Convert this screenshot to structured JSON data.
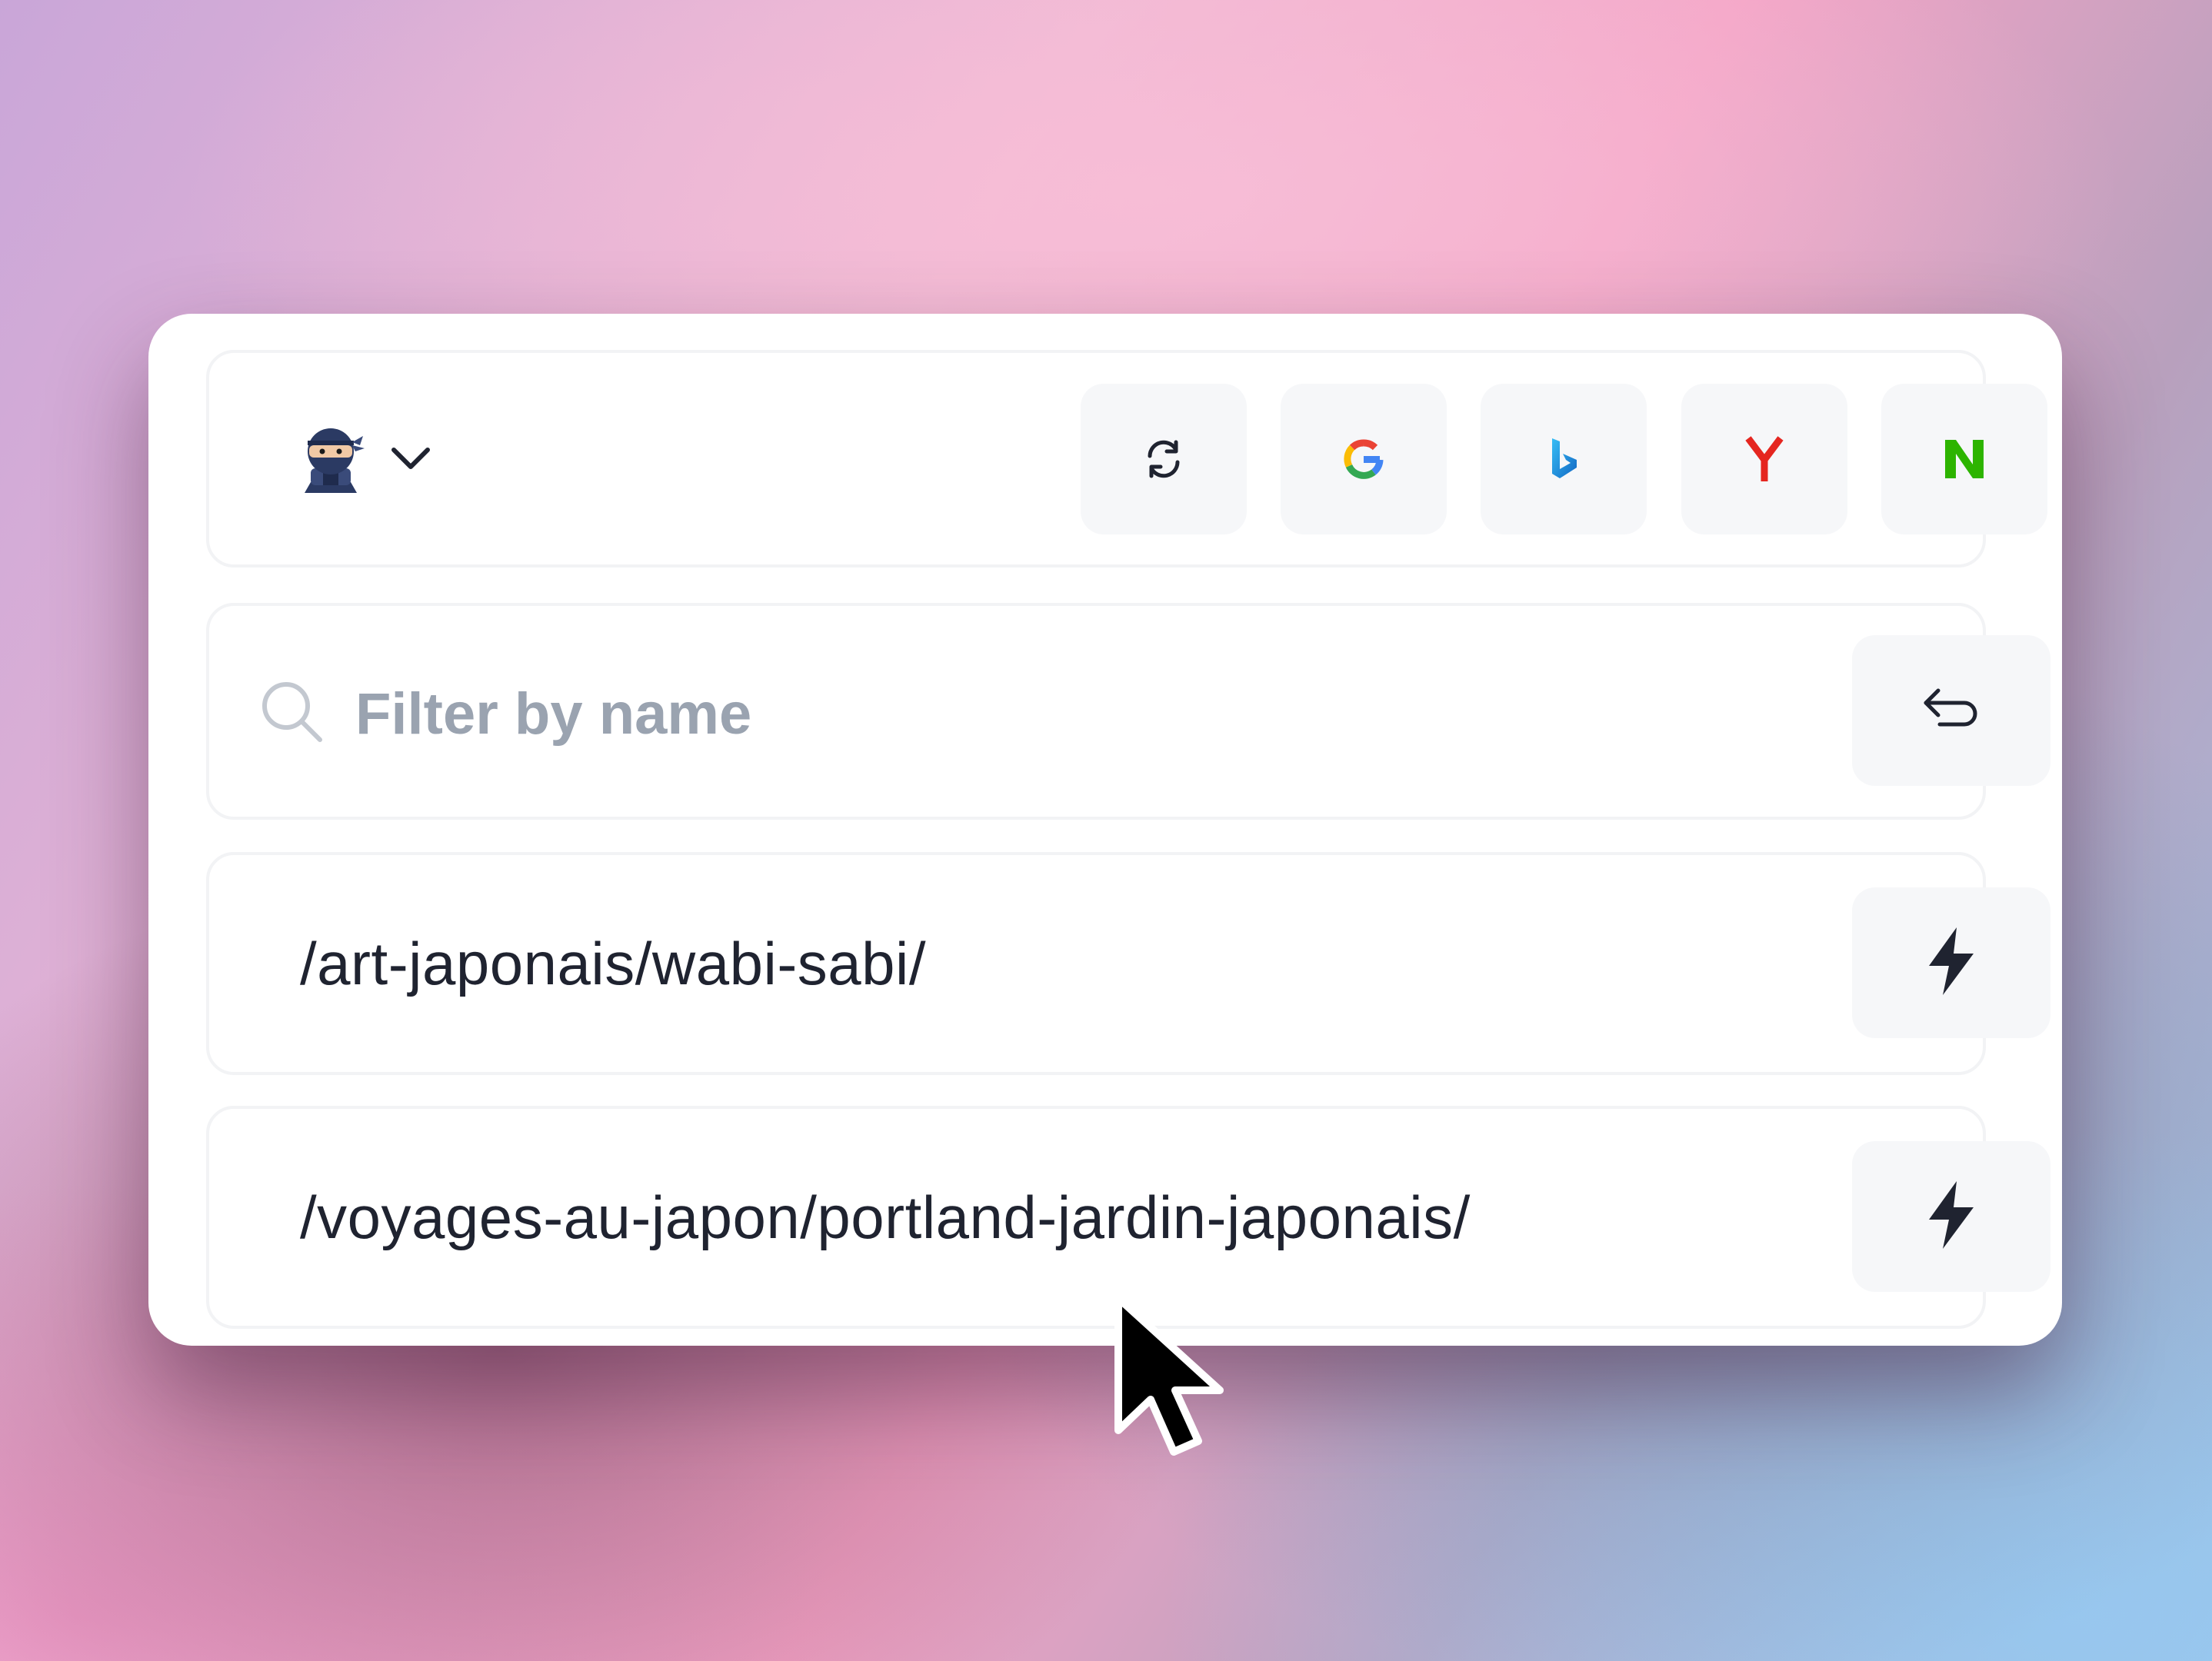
{
  "header": {
    "avatar_icon": "ninja-avatar-icon",
    "dropdown_icon": "chevron-down-icon",
    "actions": [
      {
        "name": "refresh-icon"
      },
      {
        "name": "google-icon",
        "color": "#4285F4"
      },
      {
        "name": "bing-icon",
        "color": "#1ea0d8"
      },
      {
        "name": "yandex-icon",
        "color": "#e52620"
      },
      {
        "name": "naver-icon",
        "color": "#2db400"
      }
    ]
  },
  "search": {
    "placeholder": "Filter by name",
    "value": "",
    "submit_icon": "enter-return-icon"
  },
  "results": [
    {
      "path": "/art-japonais/wabi-sabi/",
      "action_icon": "lightning-bolt-icon"
    },
    {
      "path": "/voyages-au-japon/portland-jardin-japonais/",
      "action_icon": "lightning-bolt-icon"
    }
  ]
}
